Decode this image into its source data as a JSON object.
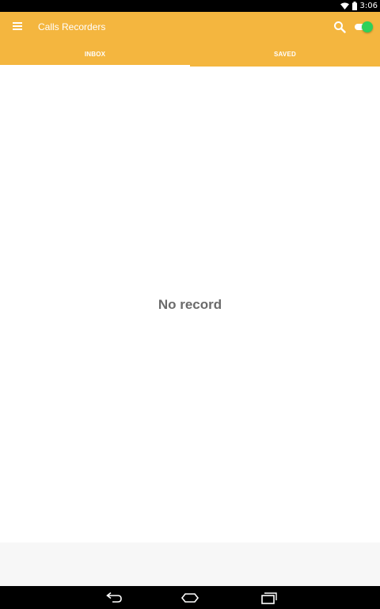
{
  "status_bar": {
    "time": "3:06",
    "icons": [
      "wifi-icon",
      "battery-icon"
    ]
  },
  "app_bar": {
    "title": "Calls Recorders",
    "menu_icon": "menu-icon",
    "search_icon": "search-icon",
    "record_toggle": {
      "on": true
    }
  },
  "tabs": [
    {
      "label": "INBOX",
      "selected": true
    },
    {
      "label": "SAVED",
      "selected": false
    }
  ],
  "content": {
    "empty_message": "No record"
  },
  "nav_bar": {
    "buttons": [
      "back-icon",
      "home-icon",
      "recent-apps-icon"
    ]
  },
  "colors": {
    "app_bar": "#f4b63f",
    "toggle_on": "#2ed15a",
    "empty_text": "#6b6b6b"
  }
}
